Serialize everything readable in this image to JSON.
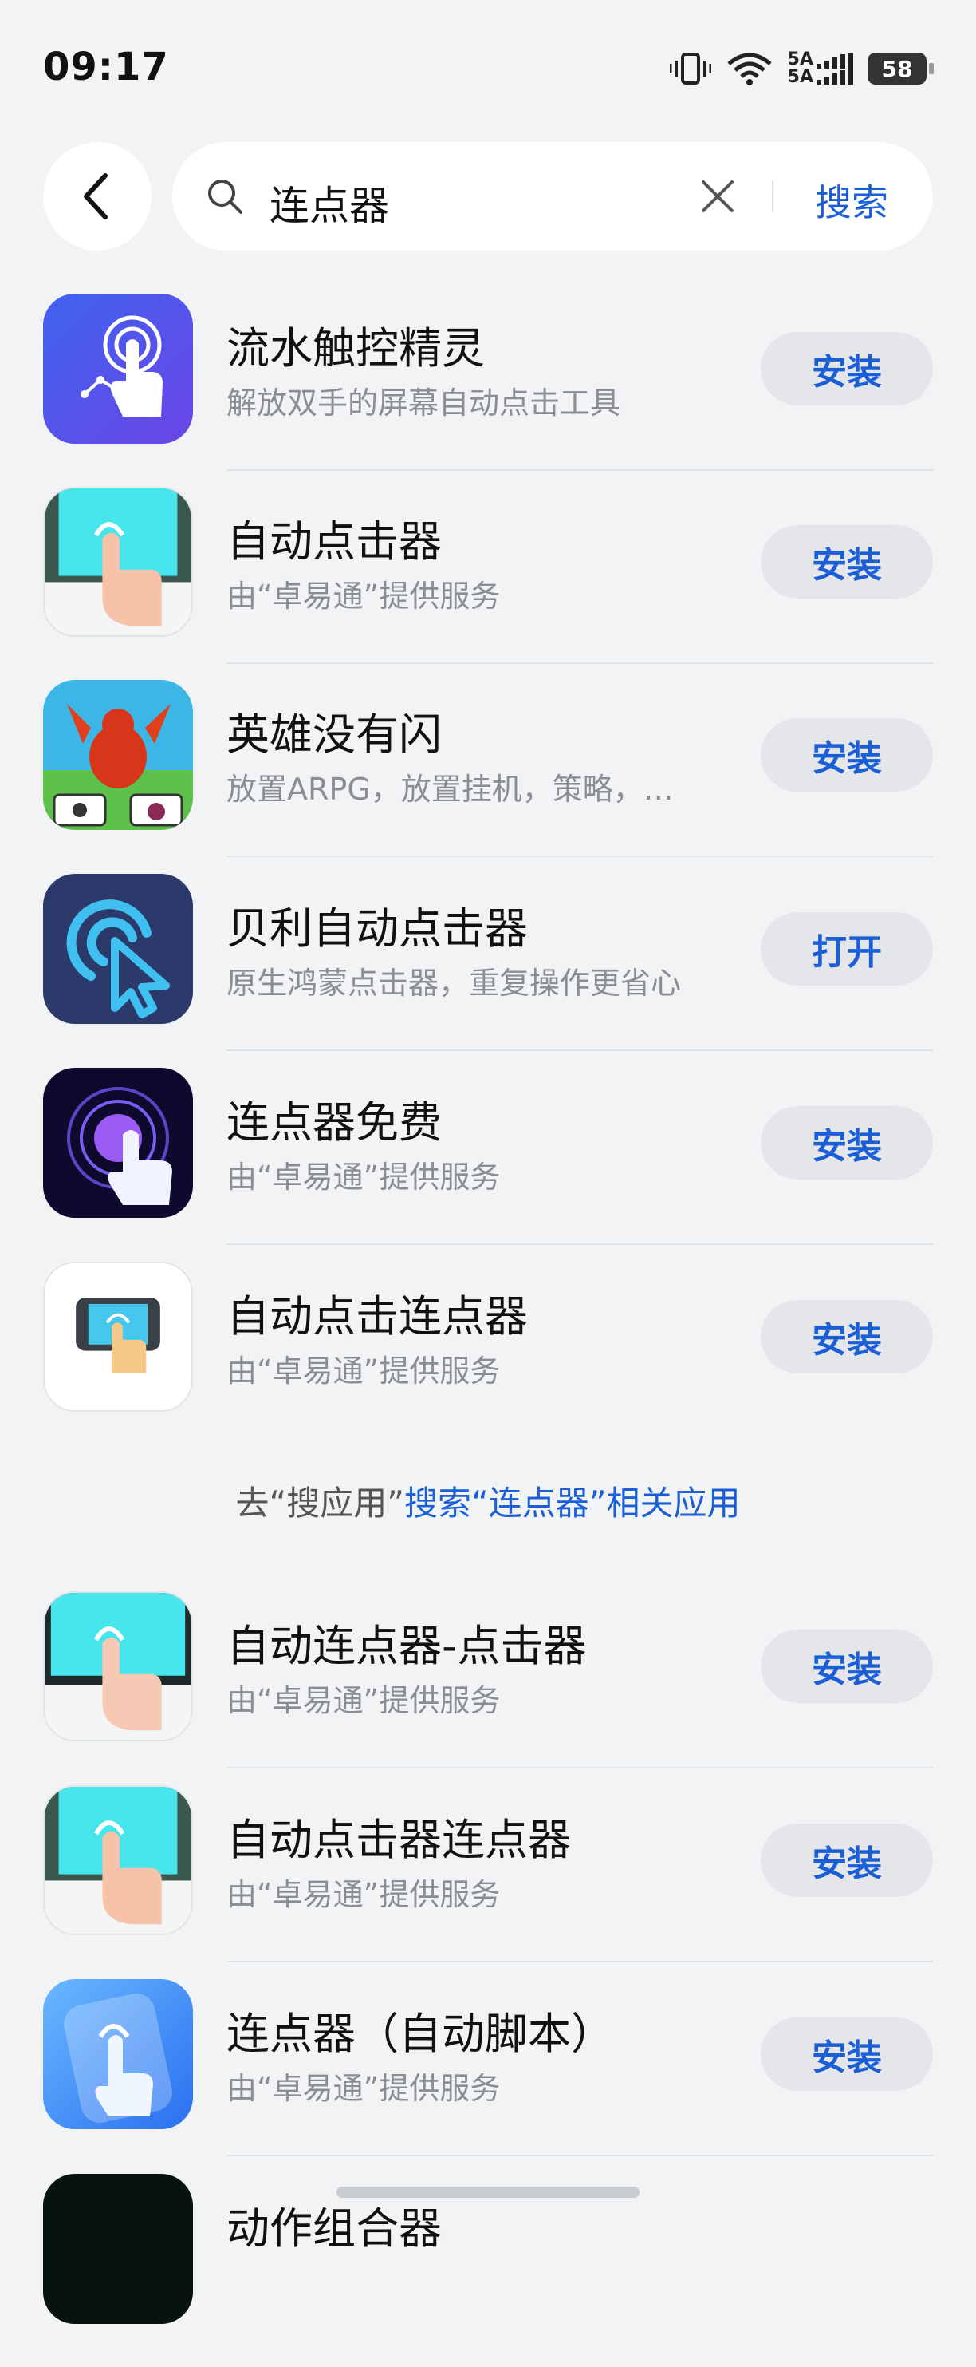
{
  "status_bar": {
    "time": "09:17",
    "signal_label_1": "5A",
    "signal_label_2": "5A",
    "battery": "58"
  },
  "search": {
    "query": "连点器",
    "button_label": "搜索"
  },
  "apps_top": [
    {
      "name": "流水触控精灵",
      "desc": "解放双手的屏幕自动点击工具",
      "action": "安装"
    },
    {
      "name": "自动点击器",
      "desc": "由“卓易通”提供服务",
      "action": "安装"
    },
    {
      "name": "英雄没有闪",
      "desc": "放置ARPG，放置挂机，策略，…",
      "action": "安装"
    },
    {
      "name": "贝利自动点击器",
      "desc": "原生鸿蒙点击器，重复操作更省心",
      "action": "打开"
    },
    {
      "name": "连点器免费",
      "desc": "由“卓易通”提供服务",
      "action": "安装"
    },
    {
      "name": "自动点击连点器",
      "desc": "由“卓易通”提供服务",
      "action": "安装"
    }
  ],
  "redirect": {
    "prefix": "去“搜应用”",
    "link": "搜索“连点器”相关应用"
  },
  "apps_bottom": [
    {
      "name": "自动连点器-点击器",
      "desc": "由“卓易通”提供服务",
      "action": "安装"
    },
    {
      "name": "自动点击器连点器",
      "desc": "由“卓易通”提供服务",
      "action": "安装"
    },
    {
      "name": "连点器（自动脚本）",
      "desc": "由“卓易通”提供服务",
      "action": "安装"
    },
    {
      "name": "动作组合器",
      "desc": "",
      "action": ""
    }
  ]
}
